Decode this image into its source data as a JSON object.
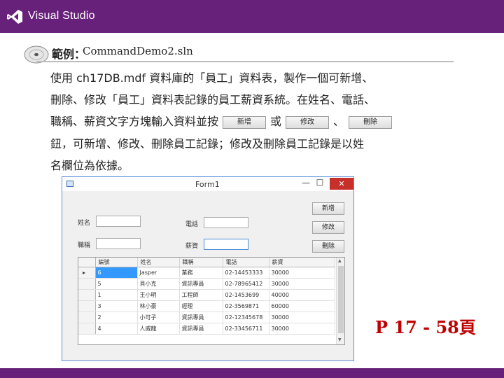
{
  "brand": {
    "title": "Visual Studio"
  },
  "example": {
    "label": "範例：",
    "file": "CommandDemo2.sln"
  },
  "paragraph": {
    "line1": "使用 ch17DB.mdf 資料庫的「員工」資料表，製作一個可新增、",
    "line2": "刪除、修改「員工」資料表記錄的員工薪資系統。在姓名、電話、",
    "line3_a": "職稱、薪資文字方塊輸入資料並按",
    "line3_b": "或",
    "line3_c": "、",
    "line4": "鈕，可新增、修改、刪除員工記錄；修改及刪除員工記錄是以姓",
    "line5": "名欄位為依據。",
    "btn_add": "新增",
    "btn_edit": "修改",
    "btn_delete": "刪除"
  },
  "form": {
    "title": "Form1",
    "min": "—",
    "max": "☐",
    "close": "✕",
    "labels": {
      "name": "姓名",
      "title": "職稱",
      "phone": "電話",
      "salary": "薪資"
    },
    "buttons": {
      "add": "新增",
      "edit": "修改",
      "delete": "刪除"
    },
    "grid": {
      "columns": [
        "編號",
        "姓名",
        "職稱",
        "電話",
        "薪資"
      ],
      "rows": [
        [
          "6",
          "Jasper",
          "業務",
          "02-14453333",
          "30000"
        ],
        [
          "5",
          "貝小克",
          "資訊專員",
          "02-78965412",
          "30000"
        ],
        [
          "1",
          "王小明",
          "工程師",
          "02-1453699",
          "40000"
        ],
        [
          "3",
          "林小豪",
          "經理",
          "02-3569871",
          "60000"
        ],
        [
          "2",
          "小可子",
          "資訊專員",
          "02-12345678",
          "30000"
        ],
        [
          "4",
          "人威龍",
          "資訊專員",
          "02-33456711",
          "30000"
        ]
      ],
      "current_row_marker": "▸"
    }
  },
  "page_ref": "P 17 - 58頁",
  "colors": {
    "brand": "#68217a",
    "pageref": "#c00000",
    "selection": "#3399ff"
  }
}
